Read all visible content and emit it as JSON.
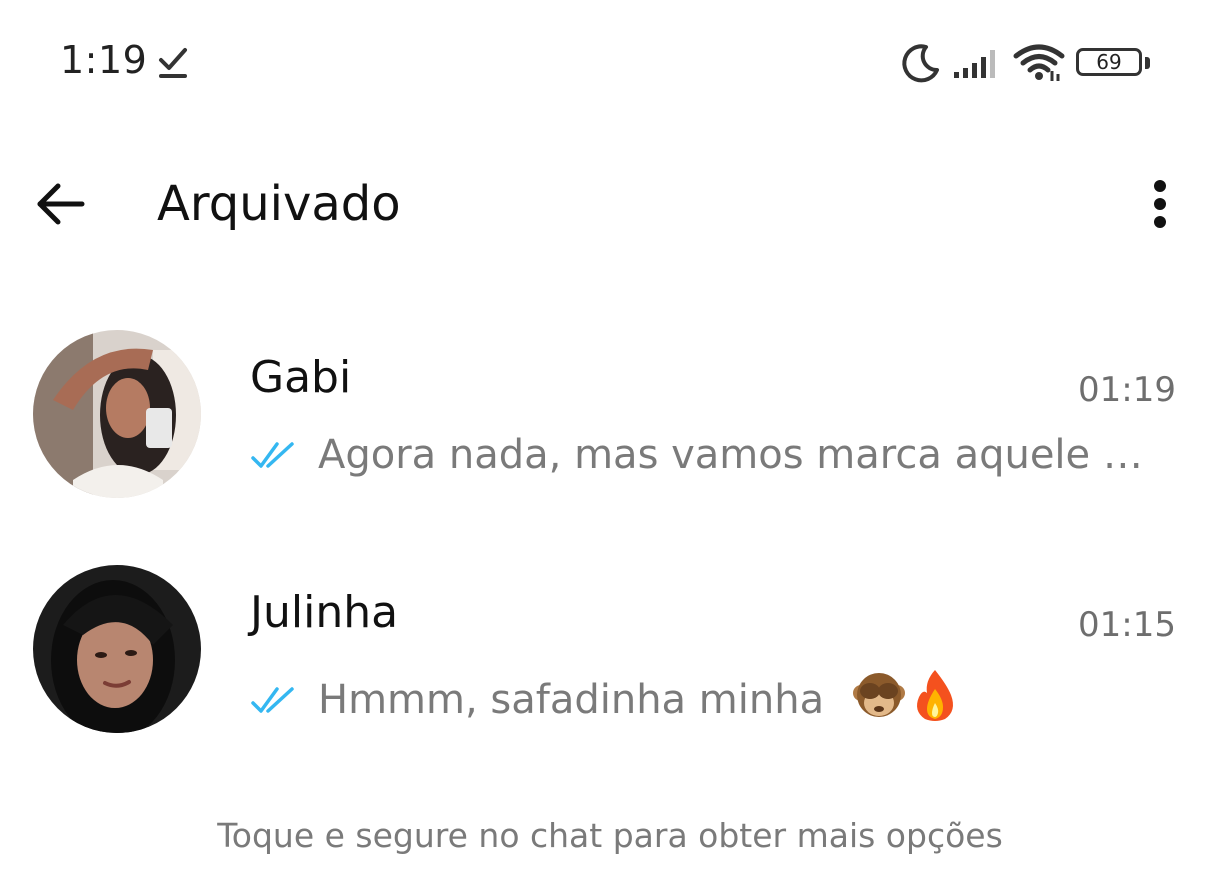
{
  "status_bar": {
    "time": "1:19",
    "battery_level": "69"
  },
  "header": {
    "title": "Arquivado"
  },
  "chats": [
    {
      "name": "Gabi",
      "time": "01:19",
      "preview": "Agora nada, mas vamos marca aquele …",
      "read_status": "read"
    },
    {
      "name": "Julinha",
      "time": "01:15",
      "preview": "Hmmm, safadinha minha",
      "emojis": [
        "see-no-evil-monkey-emoji",
        "fire-emoji"
      ],
      "read_status": "read"
    }
  ],
  "footer": {
    "hint": "Toque e segure no chat para obter mais opções"
  },
  "colors": {
    "read_ticks": "#34b7f1",
    "muted_text": "#7a7a7a"
  }
}
